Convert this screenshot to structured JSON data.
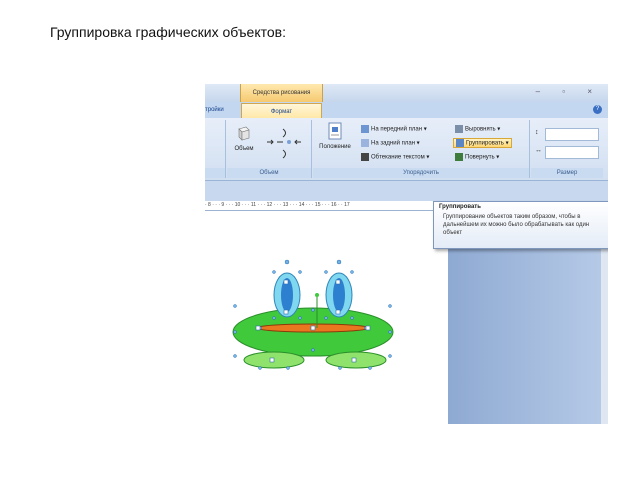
{
  "slide": {
    "title": "Группировка графических объектов:"
  },
  "window": {
    "context_tab": "Средства рисования",
    "win_buttons": "– ▫ ×"
  },
  "tabs": {
    "left": "тройки",
    "active": "Формат",
    "help": "?"
  },
  "ribbon": {
    "objects_btn": "Объем",
    "volume_group": "Объем",
    "position_btn": "Положение",
    "arrange_group": "Упорядочить",
    "size_group": "Размер",
    "arrange_items": {
      "front": "На передний план",
      "back": "На задний план",
      "wrap": "Обтекание текстом",
      "align": "Выровнять",
      "group": "Группировать",
      "rotate": "Повернуть"
    }
  },
  "ruler": {
    "text": "· 8 · · · 9 · · · 10 · · · 11 · · · 12 · · · 13 · · · 14 · · · 15 · · · 16 · · 17"
  },
  "tooltip": {
    "title": "Группировать",
    "text": "Группирование объектов таким образом, чтобы в дальнейшем их можно было обрабатывать как один объект"
  }
}
